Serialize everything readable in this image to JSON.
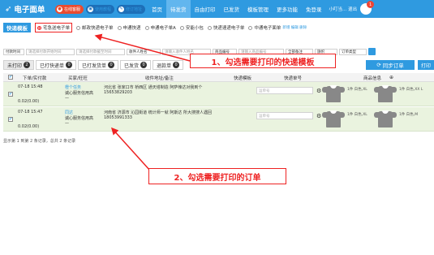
{
  "nav": {
    "title": "电子面单",
    "pill_online": "在线客服",
    "pill_tutorial": "使用教程",
    "pill_address": "修订地址",
    "items": [
      "首页",
      "待发货",
      "自由打印",
      "已发货",
      "模板管理",
      "更多功能",
      "免登录"
    ],
    "active_index": 1,
    "user": "小叮当...  退出",
    "badge": "1"
  },
  "templates": {
    "label": "快递模板",
    "items": [
      {
        "name": "宅急送电子单",
        "count": "",
        "selected": true
      },
      {
        "name": "邮政快递电子单",
        "count": "",
        "selected": false
      },
      {
        "name": "申通快递",
        "count": "",
        "selected": false
      },
      {
        "name": "申通电子单A",
        "count": "",
        "selected": false
      },
      {
        "name": "安能小包",
        "count": "",
        "selected": false
      },
      {
        "name": "快递速递电子单",
        "count": "",
        "selected": false
      },
      {
        "name": "中通电子面单",
        "count": "",
        "selected": false
      }
    ],
    "actions": "新增 编辑 删除"
  },
  "filters": {
    "f1": "付款时间",
    "f2": "请选择付款开始时间",
    "f3": "请选择付款截至时间",
    "f4": "收件人姓名",
    "f5": "请输入收件人姓名",
    "f6": "商品编号",
    "f7": "请输入商品编号",
    "f8": "全部备注",
    "f9": "旗帜",
    "f10": "订单类型"
  },
  "tabs": [
    {
      "label": "未打印",
      "count": "2",
      "dark": true
    },
    {
      "label": "已打快递单",
      "count": "0",
      "dark": true
    },
    {
      "label": "已打发货单",
      "count": "0",
      "dark": true
    },
    {
      "label": "已发货",
      "count": "0",
      "dark": true
    },
    {
      "label": "退款单",
      "count": "0",
      "dark": true
    }
  ],
  "sync_button": "同步订单",
  "print_button": "打印",
  "table": {
    "headers": [
      "下单/实付款",
      "买家/旺旺",
      "收件地址/备注",
      "快递模板",
      "快递单号",
      "商品信息"
    ],
    "rows": [
      {
        "time": "07-18 15:48",
        "pay": "0.02(0.00)",
        "buyer": "橙个任务",
        "buyer_sub": "诚心服务信用高",
        "buyer_sub2": "—",
        "address": "河北省 张家口市 桥西区 通天塔制造 阿萨辣达对我到个",
        "phone": "15653829203",
        "waybill_placeholder": "运单号",
        "spec1": "1件 白色,XL",
        "spec2": "1件 白色,XX L"
      },
      {
        "time": "07-18 15:47",
        "pay": "0.02(0.00)",
        "buyer": "同达",
        "buyer_sub": "诚心服务信用高",
        "buyer_sub2": "—",
        "address": "河南省 济源市 沁园街道 统计师一就 阿斯达 所大搜搜人遇回",
        "phone": "18053991333",
        "waybill_placeholder": "运单号",
        "spec1": "1件 白色,XL",
        "spec2": "1件 白色,M"
      }
    ]
  },
  "footer": "显示第 1 到第 2 条记录，总共 2 条记录",
  "annotations": {
    "step1": "1、勾选需要打印的快递模板",
    "step2": "2、勾选需要打印的订单"
  },
  "colors": {
    "primary": "#2f9ae0",
    "annotation": "#e22",
    "row_bg": "#eaf3df"
  }
}
